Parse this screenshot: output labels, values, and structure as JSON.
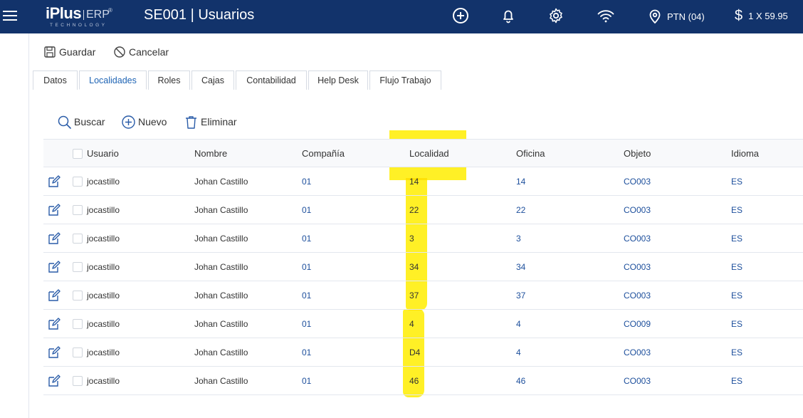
{
  "topbar": {
    "logo": {
      "main": "iPlus",
      "suffix": "ERP",
      "reg": "®",
      "tagline": "TECHNOLOGY"
    },
    "title": "SE001 | Usuarios",
    "icons": [
      "plus-circle-icon",
      "bell-icon",
      "gear-icon",
      "wifi-icon",
      "map-pin-icon",
      "dollar-icon"
    ],
    "location": "PTN (04)",
    "currency_symbol": "$",
    "exchange": "1 X 59.95",
    "colors": {
      "bar": "#12336b"
    }
  },
  "actions": {
    "save": "Guardar",
    "cancel": "Cancelar"
  },
  "tabs": [
    {
      "label": "Datos"
    },
    {
      "label": "Localidades",
      "active": true
    },
    {
      "label": "Roles"
    },
    {
      "label": "Cajas"
    },
    {
      "label": "Contabilidad"
    },
    {
      "label": "Help Desk"
    },
    {
      "label": "Flujo Trabajo"
    }
  ],
  "grid_toolbar": {
    "search": "Buscar",
    "new": "Nuevo",
    "delete": "Eliminar"
  },
  "table": {
    "headers": {
      "usuario": "Usuario",
      "nombre": "Nombre",
      "compania": "Compañía",
      "localidad": "Localidad",
      "oficina": "Oficina",
      "objeto": "Objeto",
      "idioma": "Idioma"
    },
    "rows": [
      {
        "usuario": "jocastillo",
        "nombre": "Johan Castillo",
        "compania": "01",
        "localidad": "14",
        "oficina": "14",
        "objeto": "CO003",
        "idioma": "ES"
      },
      {
        "usuario": "jocastillo",
        "nombre": "Johan Castillo",
        "compania": "01",
        "localidad": "22",
        "oficina": "22",
        "objeto": "CO003",
        "idioma": "ES"
      },
      {
        "usuario": "jocastillo",
        "nombre": "Johan Castillo",
        "compania": "01",
        "localidad": "3",
        "oficina": "3",
        "objeto": "CO003",
        "idioma": "ES"
      },
      {
        "usuario": "jocastillo",
        "nombre": "Johan Castillo",
        "compania": "01",
        "localidad": "34",
        "oficina": "34",
        "objeto": "CO003",
        "idioma": "ES"
      },
      {
        "usuario": "jocastillo",
        "nombre": "Johan Castillo",
        "compania": "01",
        "localidad": "37",
        "oficina": "37",
        "objeto": "CO003",
        "idioma": "ES"
      },
      {
        "usuario": "jocastillo",
        "nombre": "Johan Castillo",
        "compania": "01",
        "localidad": "4",
        "oficina": "4",
        "objeto": "CO009",
        "idioma": "ES"
      },
      {
        "usuario": "jocastillo",
        "nombre": "Johan Castillo",
        "compania": "01",
        "localidad": "D4",
        "oficina": "4",
        "objeto": "CO003",
        "idioma": "ES"
      },
      {
        "usuario": "jocastillo",
        "nombre": "Johan Castillo",
        "compania": "01",
        "localidad": "46",
        "oficina": "46",
        "objeto": "CO003",
        "idioma": "ES"
      }
    ]
  },
  "annotation": {
    "highlight_color": "#ffee00",
    "highlighted_column": "Localidad"
  }
}
